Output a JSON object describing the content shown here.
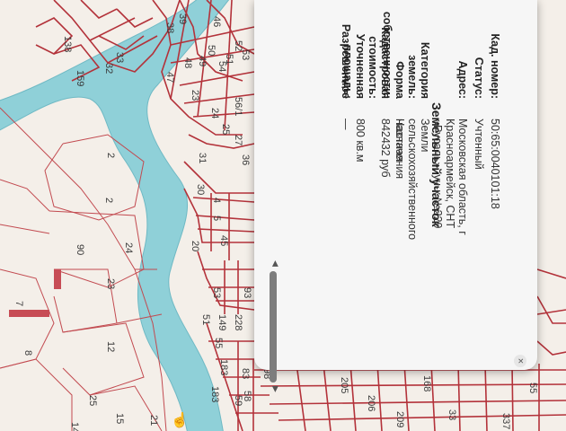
{
  "popup": {
    "title": "Земельный участок",
    "close_icon": "×",
    "rows": [
      {
        "key": "Кад. номер:",
        "value": "50:65:0040101:18"
      },
      {
        "key": "Статус:",
        "value": "Учтенный"
      },
      {
        "key": "Адрес:",
        "value": "Московская область, г Красноармейск, СНТ «Русаль», уч-к №229"
      },
      {
        "key": "Категория земель:",
        "value": "Земли сельскохозяйственного назначения"
      },
      {
        "key": "Форма собственности:",
        "value": "Частная"
      },
      {
        "key": "Кадастровая стоимость:",
        "value": "842432 руб"
      },
      {
        "key": "Уточненная площадь:",
        "value": "800 кв.м"
      },
      {
        "key": "Разрешенное",
        "value": "—"
      }
    ],
    "scroll_arrow_left": "◀",
    "scroll_arrow_right": "▶"
  },
  "map": {
    "river_color": "#8fd0d8",
    "plot_color": "#b3323a",
    "labels": [
      "138",
      "159",
      "32",
      "33",
      "39",
      "38",
      "46",
      "47",
      "48",
      "49",
      "50",
      "51",
      "52",
      "53",
      "54",
      "23",
      "24",
      "25",
      "56/1",
      "27",
      "36",
      "31",
      "30",
      "4",
      "5",
      "20",
      "45",
      "53",
      "93",
      "51",
      "149",
      "228",
      "55",
      "183",
      "183",
      "83",
      "59",
      "58",
      "98",
      "205",
      "206",
      "209",
      "168",
      "55",
      "337",
      "33",
      "2",
      "2",
      "24",
      "90",
      "23",
      "7",
      "12",
      "8",
      "25",
      "15",
      "21",
      "14",
      "1"
    ]
  },
  "cursor_icon": "☝",
  "dots": "• •"
}
